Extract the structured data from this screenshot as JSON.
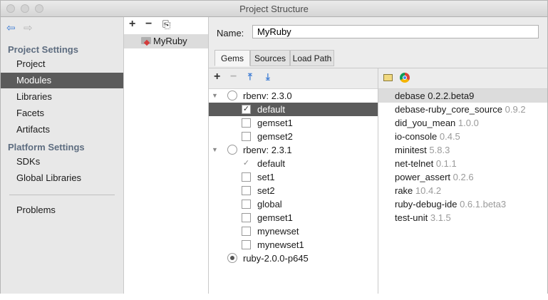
{
  "window": {
    "title": "Project Structure"
  },
  "sidebar": {
    "sections": [
      {
        "label": "Project Settings",
        "items": [
          "Project",
          "Modules",
          "Libraries",
          "Facets",
          "Artifacts"
        ]
      },
      {
        "label": "Platform Settings",
        "items": [
          "SDKs",
          "Global Libraries"
        ]
      }
    ],
    "problems": "Problems",
    "selected": "Modules"
  },
  "modules": {
    "items": [
      "MyRuby"
    ]
  },
  "detail": {
    "name_label": "Name:",
    "name_value": "MyRuby",
    "tabs": [
      "Gems",
      "Sources",
      "Load Path"
    ],
    "active_tab": "Gems"
  },
  "sdk_tree": [
    {
      "label": "rbenv: 2.3.0",
      "type": "sdk",
      "radio": false
    },
    {
      "label": "default",
      "type": "gemset",
      "checked": true,
      "selected": true
    },
    {
      "label": "gemset1",
      "type": "gemset",
      "checked": false
    },
    {
      "label": "gemset2",
      "type": "gemset",
      "checked": false
    },
    {
      "label": "rbenv: 2.3.1",
      "type": "sdk",
      "radio": false
    },
    {
      "label": "default",
      "type": "gemset",
      "checked": true,
      "ghost": true
    },
    {
      "label": "set1",
      "type": "gemset",
      "checked": false
    },
    {
      "label": "set2",
      "type": "gemset",
      "checked": false
    },
    {
      "label": "global",
      "type": "gemset",
      "checked": false
    },
    {
      "label": "gemset1",
      "type": "gemset",
      "checked": false
    },
    {
      "label": "mynewset",
      "type": "gemset",
      "checked": false
    },
    {
      "label": "mynewset1",
      "type": "gemset",
      "checked": false
    },
    {
      "label": "ruby-2.0.0-p645",
      "type": "sdk",
      "radio": true
    }
  ],
  "gems": [
    {
      "name": "debase",
      "version": "0.2.2.beta9"
    },
    {
      "name": "debase-ruby_core_source",
      "version": "0.9.2"
    },
    {
      "name": "did_you_mean",
      "version": "1.0.0"
    },
    {
      "name": "io-console",
      "version": "0.4.5"
    },
    {
      "name": "minitest",
      "version": "5.8.3"
    },
    {
      "name": "net-telnet",
      "version": "0.1.1"
    },
    {
      "name": "power_assert",
      "version": "0.2.6"
    },
    {
      "name": "rake",
      "version": "10.4.2"
    },
    {
      "name": "ruby-debug-ide",
      "version": "0.6.1.beta3"
    },
    {
      "name": "test-unit",
      "version": "3.1.5"
    }
  ],
  "icons": {
    "back": "back-arrow-icon",
    "forward": "forward-arrow-icon",
    "add": "plus-icon",
    "remove": "minus-icon",
    "copy": "copy-icon",
    "expand": "expand-all-icon",
    "collapse": "collapse-all-icon",
    "folder": "folder-icon",
    "browser": "chrome-icon"
  },
  "colors": {
    "selection": "#5b5b5b",
    "section_header": "#5e6d80",
    "accent_arrow": "#3b7bd4"
  }
}
